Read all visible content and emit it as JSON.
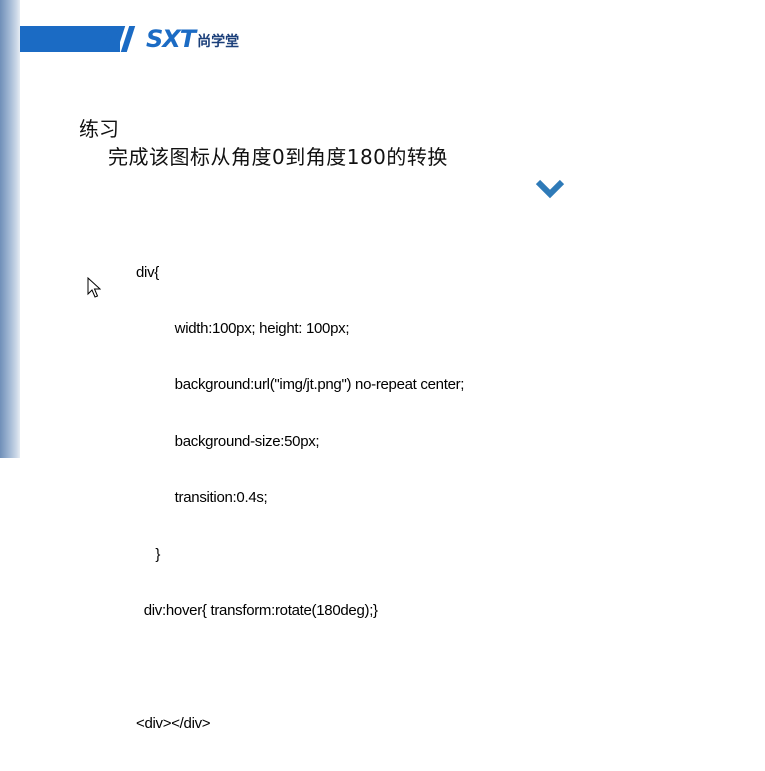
{
  "brand": {
    "logo_mark": "SXT",
    "logo_text": "尚学堂",
    "color": "#1b6bc4"
  },
  "slide": {
    "heading": "练习",
    "subheading": "完成该图标从角度0到角度180的转换",
    "icon": "chevron-down-icon",
    "code_lines": [
      "div{",
      "          width:100px; height: 100px;",
      "          background:url(\"img/jt.png\") no-repeat center;",
      "          background-size:50px;",
      "          transition:0.4s;",
      "     }",
      "  div:hover{ transform:rotate(180deg);}",
      "",
      "<div></div>"
    ]
  },
  "cursor": "arrow-cursor-icon"
}
